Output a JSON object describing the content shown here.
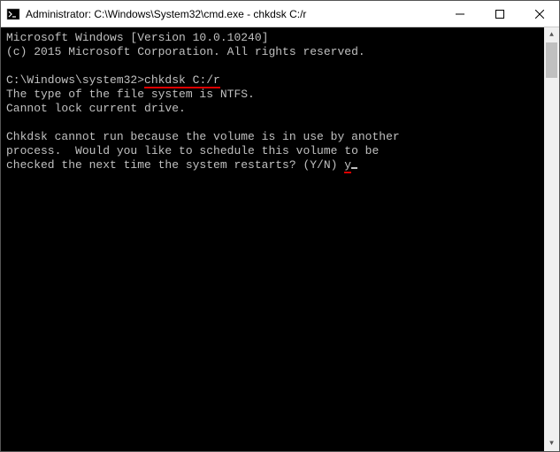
{
  "titlebar": {
    "title": "Administrator: C:\\Windows\\System32\\cmd.exe - chkdsk  C:/r"
  },
  "terminal": {
    "line1": "Microsoft Windows [Version 10.0.10240]",
    "line2": "(c) 2015 Microsoft Corporation. All rights reserved.",
    "prompt_prefix": "C:\\Windows\\system32>",
    "command": "chkdsk C:/r",
    "line4": "The type of the file system is NTFS.",
    "line5": "Cannot lock current drive.",
    "line7": "Chkdsk cannot run because the volume is in use by another",
    "line8": "process.  Would you like to schedule this volume to be",
    "line9_prefix": "checked the next time the system restarts? (Y/N) ",
    "user_input": "y"
  }
}
